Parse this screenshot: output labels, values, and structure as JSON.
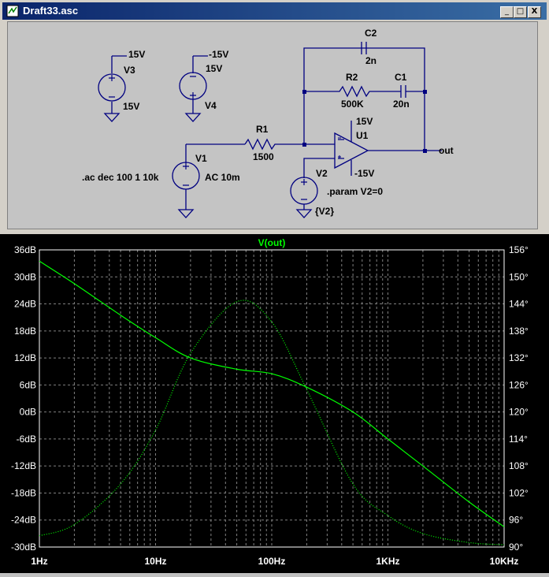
{
  "window": {
    "title": "Draft33.asc",
    "minimize": "_",
    "maximize": "□",
    "close": "X"
  },
  "schematic": {
    "labels": {
      "v3_plus": "15V",
      "v3_name": "V3",
      "v3_minus": "15V",
      "v4_plus": "-15V",
      "v4_name": "15V",
      "v4_minus": "V4",
      "c2_name": "C2",
      "c2_val": "2n",
      "r2_name": "R2",
      "r2_val": "500K",
      "c1_name": "C1",
      "c1_val": "20n",
      "r1_name": "R1",
      "r1_val": "1500",
      "u1_name": "U1",
      "u1_vpos": "15V",
      "u1_vneg": "-15V",
      "out": "out",
      "v1_name": "V1",
      "v1_val": "AC 10m",
      "ac_cmd": ".ac dec 100 1 10k",
      "v2_name": "V2",
      "param": ".param V2=0",
      "v2_val": "{V2}"
    }
  },
  "chart_data": {
    "type": "line",
    "title": "V(out)",
    "x_ticks": [
      "1Hz",
      "10Hz",
      "100Hz",
      "1KHz",
      "10KHz"
    ],
    "x_log": true,
    "xlim": [
      1,
      10000
    ],
    "y_left_ticks": [
      "36dB",
      "30dB",
      "24dB",
      "18dB",
      "12dB",
      "6dB",
      "0dB",
      "-6dB",
      "-12dB",
      "-18dB",
      "-24dB",
      "-30dB"
    ],
    "ylim_left": [
      -30,
      36
    ],
    "y_right_ticks": [
      "156°",
      "150°",
      "144°",
      "138°",
      "132°",
      "126°",
      "120°",
      "114°",
      "108°",
      "102°",
      "96°",
      "90°"
    ],
    "ylim_right": [
      90,
      156
    ],
    "grid": true,
    "series": [
      {
        "style": "solid",
        "axis": "left",
        "x": [
          1,
          2,
          5,
          10,
          20,
          50,
          100,
          200,
          500,
          1000,
          2000,
          5000,
          10000
        ],
        "y": [
          33.5,
          28.5,
          21.5,
          16.5,
          12,
          9.5,
          8.5,
          5.5,
          0,
          -6,
          -12,
          -20,
          -25.5
        ]
      },
      {
        "style": "dotted",
        "axis": "right",
        "x": [
          1,
          2,
          5,
          10,
          20,
          50,
          100,
          200,
          500,
          1000,
          2000,
          5000,
          10000
        ],
        "y": [
          92.5,
          95,
          104,
          116,
          133,
          144.5,
          140,
          125,
          104,
          97,
          93,
          91,
          90.5
        ]
      }
    ],
    "line_color": "#00ff00"
  },
  "colors": {
    "wire": "#000080",
    "title_bg": "#0a246a",
    "plot_bg": "#000000",
    "grid": "#808080",
    "trace": "#00ff00",
    "tick_text": "#ffffff"
  }
}
